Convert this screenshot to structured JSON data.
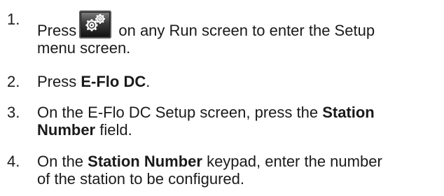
{
  "steps": [
    {
      "number": "1.",
      "before_icon": "Press",
      "icon": "setup-gears-icon",
      "after_icon": " on any Run screen to enter the Setup",
      "line2": "menu screen."
    },
    {
      "number": "2.",
      "text": "Press ",
      "bold": "E-Flo DC",
      "end": "."
    },
    {
      "number": "3.",
      "text": "On the E-Flo DC Setup screen, press the ",
      "bold": "Station",
      "line2_bold": "Number",
      "line2": " field."
    },
    {
      "number": "4.",
      "text": "On the ",
      "bold": "Station Number",
      "after": " keypad, enter the number",
      "line2": "of the station to be configured."
    }
  ]
}
